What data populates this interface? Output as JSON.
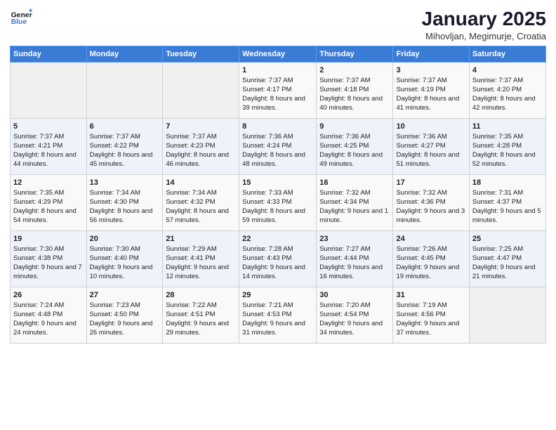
{
  "logo": {
    "line1": "General",
    "line2": "Blue"
  },
  "title": "January 2025",
  "subtitle": "Mihovljan, Megimurje, Croatia",
  "days_of_week": [
    "Sunday",
    "Monday",
    "Tuesday",
    "Wednesday",
    "Thursday",
    "Friday",
    "Saturday"
  ],
  "weeks": [
    [
      {
        "day": "",
        "data": ""
      },
      {
        "day": "",
        "data": ""
      },
      {
        "day": "",
        "data": ""
      },
      {
        "day": "1",
        "data": "Sunrise: 7:37 AM\nSunset: 4:17 PM\nDaylight: 8 hours and 39 minutes."
      },
      {
        "day": "2",
        "data": "Sunrise: 7:37 AM\nSunset: 4:18 PM\nDaylight: 8 hours and 40 minutes."
      },
      {
        "day": "3",
        "data": "Sunrise: 7:37 AM\nSunset: 4:19 PM\nDaylight: 8 hours and 41 minutes."
      },
      {
        "day": "4",
        "data": "Sunrise: 7:37 AM\nSunset: 4:20 PM\nDaylight: 8 hours and 42 minutes."
      }
    ],
    [
      {
        "day": "5",
        "data": "Sunrise: 7:37 AM\nSunset: 4:21 PM\nDaylight: 8 hours and 44 minutes."
      },
      {
        "day": "6",
        "data": "Sunrise: 7:37 AM\nSunset: 4:22 PM\nDaylight: 8 hours and 45 minutes."
      },
      {
        "day": "7",
        "data": "Sunrise: 7:37 AM\nSunset: 4:23 PM\nDaylight: 8 hours and 46 minutes."
      },
      {
        "day": "8",
        "data": "Sunrise: 7:36 AM\nSunset: 4:24 PM\nDaylight: 8 hours and 48 minutes."
      },
      {
        "day": "9",
        "data": "Sunrise: 7:36 AM\nSunset: 4:25 PM\nDaylight: 8 hours and 49 minutes."
      },
      {
        "day": "10",
        "data": "Sunrise: 7:36 AM\nSunset: 4:27 PM\nDaylight: 8 hours and 51 minutes."
      },
      {
        "day": "11",
        "data": "Sunrise: 7:35 AM\nSunset: 4:28 PM\nDaylight: 8 hours and 52 minutes."
      }
    ],
    [
      {
        "day": "12",
        "data": "Sunrise: 7:35 AM\nSunset: 4:29 PM\nDaylight: 8 hours and 54 minutes."
      },
      {
        "day": "13",
        "data": "Sunrise: 7:34 AM\nSunset: 4:30 PM\nDaylight: 8 hours and 56 minutes."
      },
      {
        "day": "14",
        "data": "Sunrise: 7:34 AM\nSunset: 4:32 PM\nDaylight: 8 hours and 57 minutes."
      },
      {
        "day": "15",
        "data": "Sunrise: 7:33 AM\nSunset: 4:33 PM\nDaylight: 8 hours and 59 minutes."
      },
      {
        "day": "16",
        "data": "Sunrise: 7:32 AM\nSunset: 4:34 PM\nDaylight: 9 hours and 1 minute."
      },
      {
        "day": "17",
        "data": "Sunrise: 7:32 AM\nSunset: 4:36 PM\nDaylight: 9 hours and 3 minutes."
      },
      {
        "day": "18",
        "data": "Sunrise: 7:31 AM\nSunset: 4:37 PM\nDaylight: 9 hours and 5 minutes."
      }
    ],
    [
      {
        "day": "19",
        "data": "Sunrise: 7:30 AM\nSunset: 4:38 PM\nDaylight: 9 hours and 7 minutes."
      },
      {
        "day": "20",
        "data": "Sunrise: 7:30 AM\nSunset: 4:40 PM\nDaylight: 9 hours and 10 minutes."
      },
      {
        "day": "21",
        "data": "Sunrise: 7:29 AM\nSunset: 4:41 PM\nDaylight: 9 hours and 12 minutes."
      },
      {
        "day": "22",
        "data": "Sunrise: 7:28 AM\nSunset: 4:43 PM\nDaylight: 9 hours and 14 minutes."
      },
      {
        "day": "23",
        "data": "Sunrise: 7:27 AM\nSunset: 4:44 PM\nDaylight: 9 hours and 16 minutes."
      },
      {
        "day": "24",
        "data": "Sunrise: 7:26 AM\nSunset: 4:45 PM\nDaylight: 9 hours and 19 minutes."
      },
      {
        "day": "25",
        "data": "Sunrise: 7:25 AM\nSunset: 4:47 PM\nDaylight: 9 hours and 21 minutes."
      }
    ],
    [
      {
        "day": "26",
        "data": "Sunrise: 7:24 AM\nSunset: 4:48 PM\nDaylight: 9 hours and 24 minutes."
      },
      {
        "day": "27",
        "data": "Sunrise: 7:23 AM\nSunset: 4:50 PM\nDaylight: 9 hours and 26 minutes."
      },
      {
        "day": "28",
        "data": "Sunrise: 7:22 AM\nSunset: 4:51 PM\nDaylight: 9 hours and 29 minutes."
      },
      {
        "day": "29",
        "data": "Sunrise: 7:21 AM\nSunset: 4:53 PM\nDaylight: 9 hours and 31 minutes."
      },
      {
        "day": "30",
        "data": "Sunrise: 7:20 AM\nSunset: 4:54 PM\nDaylight: 9 hours and 34 minutes."
      },
      {
        "day": "31",
        "data": "Sunrise: 7:19 AM\nSunset: 4:56 PM\nDaylight: 9 hours and 37 minutes."
      },
      {
        "day": "",
        "data": ""
      }
    ]
  ]
}
